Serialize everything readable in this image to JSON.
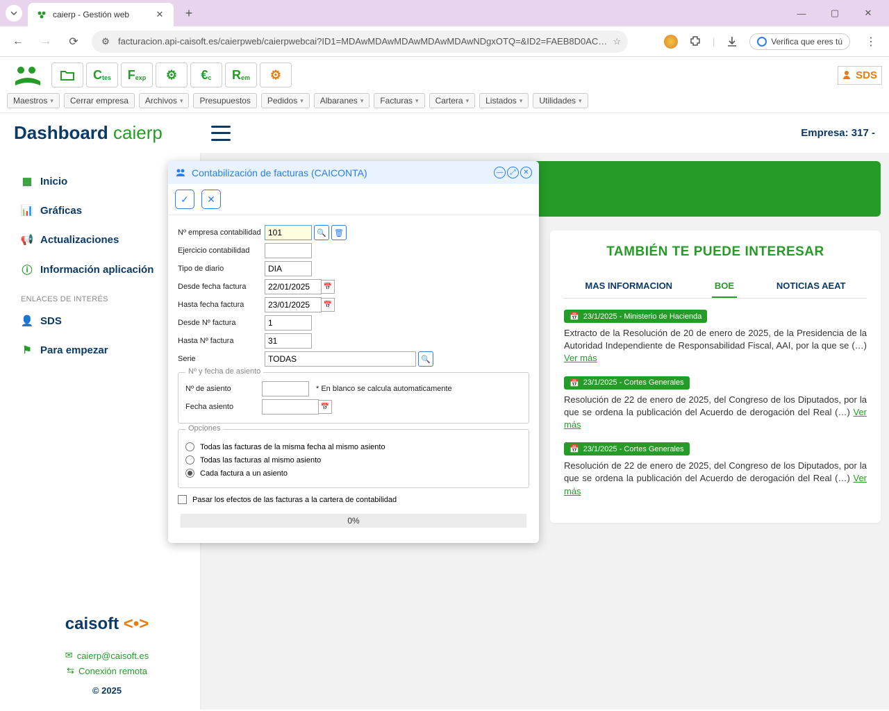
{
  "browser": {
    "tab_title": "caierp - Gestión web",
    "url": "facturacion.api-caisoft.es/caierpweb/caierpwebcai?ID1=MDAwMDAwMDAwMDAwMDAwNDgxOTQ=&ID2=FAEB8D0AC…",
    "identity": "Verifica que eres tú"
  },
  "toolbar": {
    "btns": [
      "folder",
      "Ctes",
      "Fexp",
      "gear",
      "€c",
      "Rem",
      "gear2"
    ],
    "sds": "SDS"
  },
  "menus": [
    "Maestros",
    "Cerrar empresa",
    "Archivos",
    "Presupuestos",
    "Pedidos",
    "Albaranes",
    "Facturas",
    "Cartera",
    "Listados",
    "Utilidades"
  ],
  "menus_dropdown": [
    true,
    false,
    true,
    false,
    true,
    true,
    true,
    true,
    true,
    true
  ],
  "dash": {
    "title1": "Dashboard ",
    "title2": "caierp",
    "empresa": "Empresa: 317 -"
  },
  "sidebar": {
    "items": [
      {
        "icon": "grid",
        "label": "Inicio"
      },
      {
        "icon": "chart",
        "label": "Gráficas"
      },
      {
        "icon": "megaphone",
        "label": "Actualizaciones"
      },
      {
        "icon": "info",
        "label": "Información aplicación"
      }
    ],
    "heading": "ENLACES DE INTERÉS",
    "links": [
      {
        "icon": "person",
        "label": "SDS"
      },
      {
        "icon": "flag",
        "label": "Para empezar"
      }
    ],
    "footer_logo": "caisoft ",
    "footer_email": "caierp@caisoft.es",
    "footer_remote": "Conexión remota",
    "copyright": "© 2025"
  },
  "interest": {
    "title": "TAMBIÉN TE PUEDE INTERESAR",
    "tabs": [
      "MAS INFORMACION",
      "BOE",
      "NOTICIAS AEAT"
    ],
    "active_tab": 1,
    "news": [
      {
        "badge": "23/1/2025 - Ministerio de Hacienda",
        "text": "Extracto de la Resolución de 20 de enero de 2025, de la Presidencia de la Autoridad Independiente de Responsabilidad Fiscal, AAI, por la que se (…) ",
        "link": "Ver más"
      },
      {
        "badge": "23/1/2025 - Cortes Generales",
        "text": "Resolución de 22 de enero de 2025, del Congreso de los Diputados, por la que se ordena la publicación del Acuerdo de derogación del Real (…) ",
        "link": "Ver más"
      },
      {
        "badge": "23/1/2025 - Cortes Generales",
        "text": "Resolución de 22 de enero de 2025, del Congreso de los Diputados, por la que se ordena la publicación del Acuerdo de derogación del Real (…) ",
        "link": "Ver más"
      }
    ]
  },
  "modal": {
    "title": "Contabilización de facturas (CAICONTA)",
    "fields": {
      "empresa_label": "Nº empresa contabilidad",
      "empresa_val": "101",
      "ejercicio_label": "Ejercicio contabilidad",
      "ejercicio_val": "",
      "tipo_label": "Tipo de diario",
      "tipo_val": "DIA",
      "desde_fecha_label": "Desde fecha factura",
      "desde_fecha_val": "22/01/2025",
      "hasta_fecha_label": "Hasta fecha factura",
      "hasta_fecha_val": "23/01/2025",
      "desde_num_label": "Desde Nº factura",
      "desde_num_val": "1",
      "hasta_num_label": "Hasta Nº factura",
      "hasta_num_val": "31",
      "serie_label": "Serie",
      "serie_val": "TODAS"
    },
    "asiento": {
      "legend": "Nº y fecha de asiento",
      "num_label": "Nº de asiento",
      "num_val": "",
      "hint": "* En blanco se calcula automaticamente",
      "fecha_label": "Fecha asiento",
      "fecha_val": ""
    },
    "opciones": {
      "legend": "Opciones",
      "opts": [
        "Todas las facturas de la misma fecha al mismo asiento",
        "Todas las facturas al mismo asiento",
        "Cada factura a un asiento"
      ],
      "selected": 2
    },
    "check_label": "Pasar los efectos de las facturas a la cartera de contabilidad",
    "progress": "0%"
  }
}
